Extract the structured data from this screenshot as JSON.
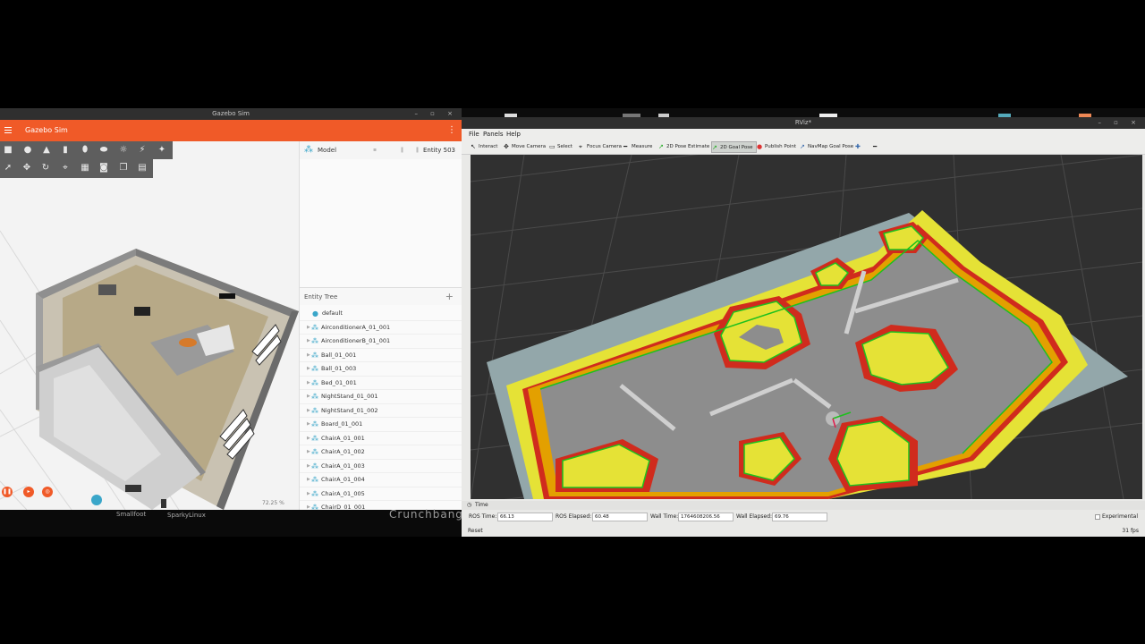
{
  "gazebo": {
    "window_title": "Gazebo Sim",
    "app_title": "Gazebo Sim",
    "menu_dots": "⋮",
    "zoom": "72.25 %",
    "model_panel": {
      "label": "Model",
      "entity": "Entity 503"
    },
    "entity_tree": {
      "header": "Entity Tree",
      "items": [
        "default",
        "AirconditionerA_01_001",
        "AirconditionerB_01_001",
        "Ball_01_001",
        "Ball_01_003",
        "Bed_01_001",
        "NightStand_01_001",
        "NightStand_01_002",
        "Board_01_001",
        "ChairA_01_001",
        "ChairA_01_002",
        "ChairA_01_003",
        "ChairA_01_004",
        "ChairA_01_005",
        "ChairD_01_001"
      ]
    },
    "toolbar_icons": [
      "box-icon",
      "sphere-icon",
      "cone-icon",
      "cylinder-icon",
      "capsule-icon",
      "ellipsoid-icon",
      "sun-icon",
      "spotlight-icon",
      "pointlight-icon",
      "select-icon",
      "translate-icon",
      "rotate-icon",
      "snap-icon",
      "grid-icon",
      "screenshot-icon",
      "copy-icon",
      "paste-icon"
    ],
    "accent_color": "#f05a28"
  },
  "desktop": {
    "label_left": "Smallfoot",
    "label_mid": "SparkyLinux",
    "label_right": "Crunchbang"
  },
  "rviz": {
    "window_title": "RViz*",
    "menu": [
      "File",
      "Panels",
      "Help"
    ],
    "tools": [
      "Interact",
      "Move Camera",
      "Select",
      "Focus Camera",
      "Measure",
      "2D Pose Estimate",
      "2D Goal Pose",
      "Publish Point",
      "NavMap Goal Pose"
    ],
    "active_tool": "2D Goal Pose",
    "time_panel": {
      "header": "Time",
      "ros_time_label": "ROS Time:",
      "ros_time": "66.13",
      "ros_elapsed_label": "ROS Elapsed:",
      "ros_elapsed": "60.48",
      "wall_time_label": "Wall Time:",
      "wall_time": "1764608206.56",
      "wall_elapsed_label": "Wall Elapsed:",
      "wall_elapsed": "69.76",
      "experimental": "Experimental"
    },
    "reset": "Reset",
    "fps": "31 fps",
    "colors": {
      "costmap_lethal": "#e7e43a",
      "inflation": "#d52b1e",
      "free": "#8e8e8e",
      "background": "#303030"
    }
  }
}
